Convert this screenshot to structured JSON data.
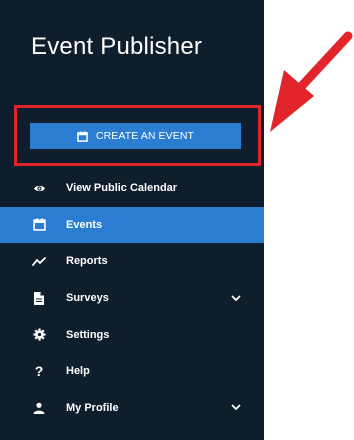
{
  "app": {
    "title": "Event Publisher"
  },
  "create_button": {
    "label": "CREATE AN EVENT",
    "icon": "calendar-icon"
  },
  "nav": {
    "items": [
      {
        "label": "View Public Calendar",
        "icon": "eye-icon",
        "active": false
      },
      {
        "label": "Events",
        "icon": "calendar-icon",
        "active": true
      },
      {
        "label": "Reports",
        "icon": "line-chart-icon",
        "active": false
      },
      {
        "label": "Surveys",
        "icon": "document-icon",
        "active": false,
        "expandable": true
      },
      {
        "label": "Settings",
        "icon": "gear-icon",
        "active": false
      },
      {
        "label": "Help",
        "icon": "question-icon",
        "active": false
      },
      {
        "label": "My Profile",
        "icon": "user-icon",
        "active": false,
        "expandable": true
      }
    ]
  },
  "annotation": {
    "highlight_color": "#e2242b",
    "arrow_color": "#e2242b"
  },
  "colors": {
    "sidebar_bg": "#0f1e2c",
    "accent": "#2a7dd1",
    "text": "#ffffff"
  }
}
